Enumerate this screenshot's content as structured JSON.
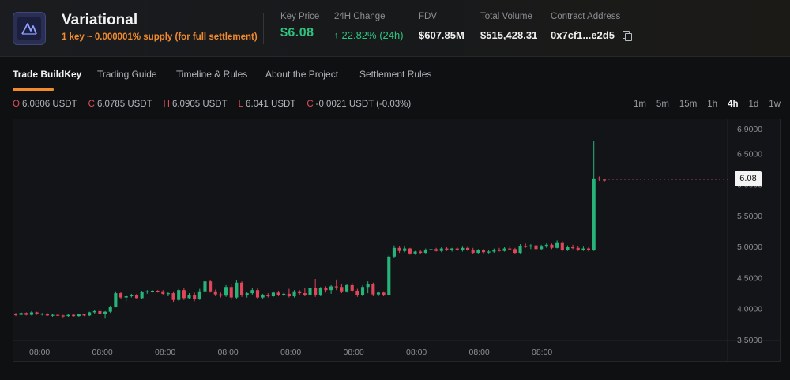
{
  "header": {
    "project_name": "Variational",
    "project_sub": "1 key ~ 0.000001% supply (for full settlement)",
    "logo_icon": "variational-logo-icon",
    "stats": {
      "key_price": {
        "label": "Key Price",
        "value": "$6.08"
      },
      "change_24h": {
        "label": "24H Change",
        "value": "22.82% (24h)",
        "arrow": "↑"
      },
      "fdv": {
        "label": "FDV",
        "value": "$607.85M"
      },
      "total_volume": {
        "label": "Total Volume",
        "value": "$515,428.31"
      },
      "contract": {
        "label": "Contract Address",
        "value": "0x7cf1...e2d5",
        "icon": "copy-icon"
      }
    }
  },
  "tabs": [
    {
      "label": "Trade BuildKey",
      "active": true
    },
    {
      "label": "Trading Guide",
      "active": false
    },
    {
      "label": "Timeline & Rules",
      "active": false
    },
    {
      "label": "About the Project",
      "active": false
    },
    {
      "label": "Settlement Rules",
      "active": false
    }
  ],
  "ohlc": {
    "o": {
      "key": "O",
      "value": "6.0806 USDT"
    },
    "c": {
      "key": "C",
      "value": "6.0785 USDT"
    },
    "h": {
      "key": "H",
      "value": "6.0905 USDT"
    },
    "l": {
      "key": "L",
      "value": "6.041 USDT"
    },
    "chg": {
      "key": "C",
      "value": "-0.0021 USDT (-0.03%)"
    }
  },
  "timeframes": [
    {
      "label": "1m",
      "active": false
    },
    {
      "label": "5m",
      "active": false
    },
    {
      "label": "15m",
      "active": false
    },
    {
      "label": "1h",
      "active": false
    },
    {
      "label": "4h",
      "active": true
    },
    {
      "label": "1d",
      "active": false
    },
    {
      "label": "1w",
      "active": false
    }
  ],
  "colors": {
    "up": "#26b47a",
    "down": "#e0455a",
    "accent": "#f28a2e"
  },
  "chart_data": {
    "type": "candlestick",
    "y_ticks": [
      "6.9000",
      "6.5000",
      "6.0000",
      "5.5000",
      "5.0000",
      "4.5000",
      "4.0000",
      "3.5000"
    ],
    "ylim": [
      3.5,
      6.9
    ],
    "x_ticks": [
      "08:00",
      "08:00",
      "08:00",
      "08:00",
      "08:00",
      "08:00",
      "08:00",
      "08:00",
      "08:00"
    ],
    "last_price_label": "6.08",
    "last_price": 6.08,
    "candles": [
      {
        "o": 3.91,
        "h": 3.93,
        "l": 3.88,
        "c": 3.9
      },
      {
        "o": 3.9,
        "h": 3.95,
        "l": 3.89,
        "c": 3.93
      },
      {
        "o": 3.93,
        "h": 3.94,
        "l": 3.89,
        "c": 3.9
      },
      {
        "o": 3.9,
        "h": 3.96,
        "l": 3.89,
        "c": 3.94
      },
      {
        "o": 3.94,
        "h": 3.95,
        "l": 3.9,
        "c": 3.91
      },
      {
        "o": 3.91,
        "h": 3.93,
        "l": 3.89,
        "c": 3.92
      },
      {
        "o": 3.92,
        "h": 3.93,
        "l": 3.88,
        "c": 3.89
      },
      {
        "o": 3.89,
        "h": 3.91,
        "l": 3.87,
        "c": 3.9
      },
      {
        "o": 3.9,
        "h": 3.92,
        "l": 3.88,
        "c": 3.89
      },
      {
        "o": 3.89,
        "h": 3.9,
        "l": 3.86,
        "c": 3.88
      },
      {
        "o": 3.88,
        "h": 3.91,
        "l": 3.87,
        "c": 3.9
      },
      {
        "o": 3.9,
        "h": 3.91,
        "l": 3.87,
        "c": 3.88
      },
      {
        "o": 3.88,
        "h": 3.92,
        "l": 3.87,
        "c": 3.91
      },
      {
        "o": 3.91,
        "h": 3.92,
        "l": 3.88,
        "c": 3.89
      },
      {
        "o": 3.89,
        "h": 3.95,
        "l": 3.88,
        "c": 3.94
      },
      {
        "o": 3.94,
        "h": 3.98,
        "l": 3.92,
        "c": 3.96
      },
      {
        "o": 3.96,
        "h": 3.99,
        "l": 3.9,
        "c": 3.92
      },
      {
        "o": 3.92,
        "h": 3.96,
        "l": 3.84,
        "c": 3.95
      },
      {
        "o": 3.95,
        "h": 4.05,
        "l": 3.93,
        "c": 4.03
      },
      {
        "o": 4.03,
        "h": 4.28,
        "l": 4.02,
        "c": 4.25
      },
      {
        "o": 4.25,
        "h": 4.27,
        "l": 4.16,
        "c": 4.18
      },
      {
        "o": 4.18,
        "h": 4.22,
        "l": 4.12,
        "c": 4.2
      },
      {
        "o": 4.2,
        "h": 4.24,
        "l": 4.18,
        "c": 4.22
      },
      {
        "o": 4.22,
        "h": 4.24,
        "l": 4.15,
        "c": 4.17
      },
      {
        "o": 4.17,
        "h": 4.29,
        "l": 4.16,
        "c": 4.27
      },
      {
        "o": 4.27,
        "h": 4.3,
        "l": 4.24,
        "c": 4.28
      },
      {
        "o": 4.28,
        "h": 4.3,
        "l": 4.26,
        "c": 4.29
      },
      {
        "o": 4.29,
        "h": 4.3,
        "l": 4.26,
        "c": 4.28
      },
      {
        "o": 4.28,
        "h": 4.3,
        "l": 4.22,
        "c": 4.24
      },
      {
        "o": 4.24,
        "h": 4.27,
        "l": 4.2,
        "c": 4.25
      },
      {
        "o": 4.25,
        "h": 4.28,
        "l": 4.11,
        "c": 4.14
      },
      {
        "o": 4.14,
        "h": 4.32,
        "l": 4.12,
        "c": 4.3
      },
      {
        "o": 4.3,
        "h": 4.34,
        "l": 4.14,
        "c": 4.17
      },
      {
        "o": 4.17,
        "h": 4.25,
        "l": 4.15,
        "c": 4.22
      },
      {
        "o": 4.22,
        "h": 4.26,
        "l": 4.12,
        "c": 4.15
      },
      {
        "o": 4.15,
        "h": 4.32,
        "l": 4.14,
        "c": 4.28
      },
      {
        "o": 4.28,
        "h": 4.46,
        "l": 4.26,
        "c": 4.44
      },
      {
        "o": 4.44,
        "h": 4.46,
        "l": 4.26,
        "c": 4.28
      },
      {
        "o": 4.28,
        "h": 4.31,
        "l": 4.2,
        "c": 4.23
      },
      {
        "o": 4.23,
        "h": 4.26,
        "l": 4.18,
        "c": 4.21
      },
      {
        "o": 4.21,
        "h": 4.38,
        "l": 4.19,
        "c": 4.35
      },
      {
        "o": 4.35,
        "h": 4.4,
        "l": 4.14,
        "c": 4.18
      },
      {
        "o": 4.18,
        "h": 4.46,
        "l": 4.16,
        "c": 4.42
      },
      {
        "o": 4.42,
        "h": 4.44,
        "l": 4.19,
        "c": 4.22
      },
      {
        "o": 4.22,
        "h": 4.27,
        "l": 4.18,
        "c": 4.25
      },
      {
        "o": 4.25,
        "h": 4.33,
        "l": 4.22,
        "c": 4.3
      },
      {
        "o": 4.3,
        "h": 4.33,
        "l": 4.16,
        "c": 4.18
      },
      {
        "o": 4.18,
        "h": 4.24,
        "l": 4.16,
        "c": 4.22
      },
      {
        "o": 4.22,
        "h": 4.25,
        "l": 4.18,
        "c": 4.2
      },
      {
        "o": 4.2,
        "h": 4.28,
        "l": 4.19,
        "c": 4.26
      },
      {
        "o": 4.26,
        "h": 4.29,
        "l": 4.2,
        "c": 4.22
      },
      {
        "o": 4.22,
        "h": 4.26,
        "l": 4.2,
        "c": 4.24
      },
      {
        "o": 4.24,
        "h": 4.32,
        "l": 4.18,
        "c": 4.2
      },
      {
        "o": 4.2,
        "h": 4.3,
        "l": 4.18,
        "c": 4.28
      },
      {
        "o": 4.28,
        "h": 4.3,
        "l": 4.22,
        "c": 4.25
      },
      {
        "o": 4.25,
        "h": 4.34,
        "l": 4.2,
        "c": 4.22
      },
      {
        "o": 4.22,
        "h": 4.36,
        "l": 4.2,
        "c": 4.34
      },
      {
        "o": 4.34,
        "h": 4.48,
        "l": 4.19,
        "c": 4.22
      },
      {
        "o": 4.22,
        "h": 4.35,
        "l": 4.2,
        "c": 4.33
      },
      {
        "o": 4.33,
        "h": 4.36,
        "l": 4.26,
        "c": 4.3
      },
      {
        "o": 4.3,
        "h": 4.38,
        "l": 4.24,
        "c": 4.36
      },
      {
        "o": 4.36,
        "h": 4.47,
        "l": 4.3,
        "c": 4.35
      },
      {
        "o": 4.35,
        "h": 4.4,
        "l": 4.25,
        "c": 4.28
      },
      {
        "o": 4.28,
        "h": 4.4,
        "l": 4.26,
        "c": 4.38
      },
      {
        "o": 4.38,
        "h": 4.42,
        "l": 4.26,
        "c": 4.29
      },
      {
        "o": 4.29,
        "h": 4.32,
        "l": 4.19,
        "c": 4.22
      },
      {
        "o": 4.22,
        "h": 4.38,
        "l": 4.2,
        "c": 4.35
      },
      {
        "o": 4.35,
        "h": 4.44,
        "l": 4.25,
        "c": 4.4
      },
      {
        "o": 4.4,
        "h": 4.42,
        "l": 4.2,
        "c": 4.23
      },
      {
        "o": 4.23,
        "h": 4.28,
        "l": 4.2,
        "c": 4.26
      },
      {
        "o": 4.26,
        "h": 4.28,
        "l": 4.2,
        "c": 4.22
      },
      {
        "o": 4.22,
        "h": 4.86,
        "l": 4.21,
        "c": 4.84
      },
      {
        "o": 4.84,
        "h": 5.02,
        "l": 4.82,
        "c": 4.98
      },
      {
        "o": 4.98,
        "h": 5.01,
        "l": 4.9,
        "c": 4.93
      },
      {
        "o": 4.93,
        "h": 5.0,
        "l": 4.91,
        "c": 4.97
      },
      {
        "o": 4.97,
        "h": 4.98,
        "l": 4.87,
        "c": 4.89
      },
      {
        "o": 4.89,
        "h": 4.93,
        "l": 4.87,
        "c": 4.92
      },
      {
        "o": 4.92,
        "h": 4.95,
        "l": 4.88,
        "c": 4.9
      },
      {
        "o": 4.9,
        "h": 4.97,
        "l": 4.89,
        "c": 4.95
      },
      {
        "o": 4.95,
        "h": 5.06,
        "l": 4.93,
        "c": 4.96
      },
      {
        "o": 4.96,
        "h": 4.98,
        "l": 4.92,
        "c": 4.93
      },
      {
        "o": 4.93,
        "h": 4.99,
        "l": 4.91,
        "c": 4.97
      },
      {
        "o": 4.97,
        "h": 4.99,
        "l": 4.93,
        "c": 4.95
      },
      {
        "o": 4.95,
        "h": 4.98,
        "l": 4.92,
        "c": 4.97
      },
      {
        "o": 4.97,
        "h": 4.99,
        "l": 4.93,
        "c": 4.94
      },
      {
        "o": 4.94,
        "h": 5.0,
        "l": 4.92,
        "c": 4.98
      },
      {
        "o": 4.98,
        "h": 5.0,
        "l": 4.93,
        "c": 4.94
      },
      {
        "o": 4.94,
        "h": 4.98,
        "l": 4.88,
        "c": 4.9
      },
      {
        "o": 4.9,
        "h": 4.96,
        "l": 4.89,
        "c": 4.95
      },
      {
        "o": 4.95,
        "h": 4.96,
        "l": 4.89,
        "c": 4.91
      },
      {
        "o": 4.91,
        "h": 4.94,
        "l": 4.89,
        "c": 4.92
      },
      {
        "o": 4.92,
        "h": 4.97,
        "l": 4.9,
        "c": 4.95
      },
      {
        "o": 4.95,
        "h": 4.98,
        "l": 4.92,
        "c": 4.93
      },
      {
        "o": 4.93,
        "h": 4.99,
        "l": 4.92,
        "c": 4.97
      },
      {
        "o": 4.97,
        "h": 5.0,
        "l": 4.95,
        "c": 4.96
      },
      {
        "o": 4.96,
        "h": 4.98,
        "l": 4.88,
        "c": 4.9
      },
      {
        "o": 4.9,
        "h": 5.04,
        "l": 4.89,
        "c": 5.01
      },
      {
        "o": 5.01,
        "h": 5.05,
        "l": 4.98,
        "c": 5.0
      },
      {
        "o": 5.0,
        "h": 5.04,
        "l": 4.96,
        "c": 5.02
      },
      {
        "o": 5.02,
        "h": 5.03,
        "l": 4.94,
        "c": 4.96
      },
      {
        "o": 4.96,
        "h": 5.03,
        "l": 4.95,
        "c": 5.0
      },
      {
        "o": 5.0,
        "h": 5.06,
        "l": 4.98,
        "c": 5.03
      },
      {
        "o": 5.03,
        "h": 5.05,
        "l": 4.96,
        "c": 4.98
      },
      {
        "o": 4.98,
        "h": 5.1,
        "l": 4.97,
        "c": 5.07
      },
      {
        "o": 5.07,
        "h": 5.09,
        "l": 4.92,
        "c": 4.94
      },
      {
        "o": 4.94,
        "h": 5.02,
        "l": 4.93,
        "c": 4.99
      },
      {
        "o": 4.99,
        "h": 5.03,
        "l": 4.96,
        "c": 4.98
      },
      {
        "o": 4.98,
        "h": 5.01,
        "l": 4.93,
        "c": 4.95
      },
      {
        "o": 4.95,
        "h": 5.0,
        "l": 4.93,
        "c": 4.97
      },
      {
        "o": 4.97,
        "h": 4.99,
        "l": 4.92,
        "c": 4.94
      },
      {
        "o": 4.94,
        "h": 6.7,
        "l": 4.93,
        "c": 6.1
      },
      {
        "o": 6.1,
        "h": 6.13,
        "l": 6.06,
        "c": 6.09
      },
      {
        "o": 6.0806,
        "h": 6.0905,
        "l": 6.041,
        "c": 6.0785
      }
    ]
  }
}
